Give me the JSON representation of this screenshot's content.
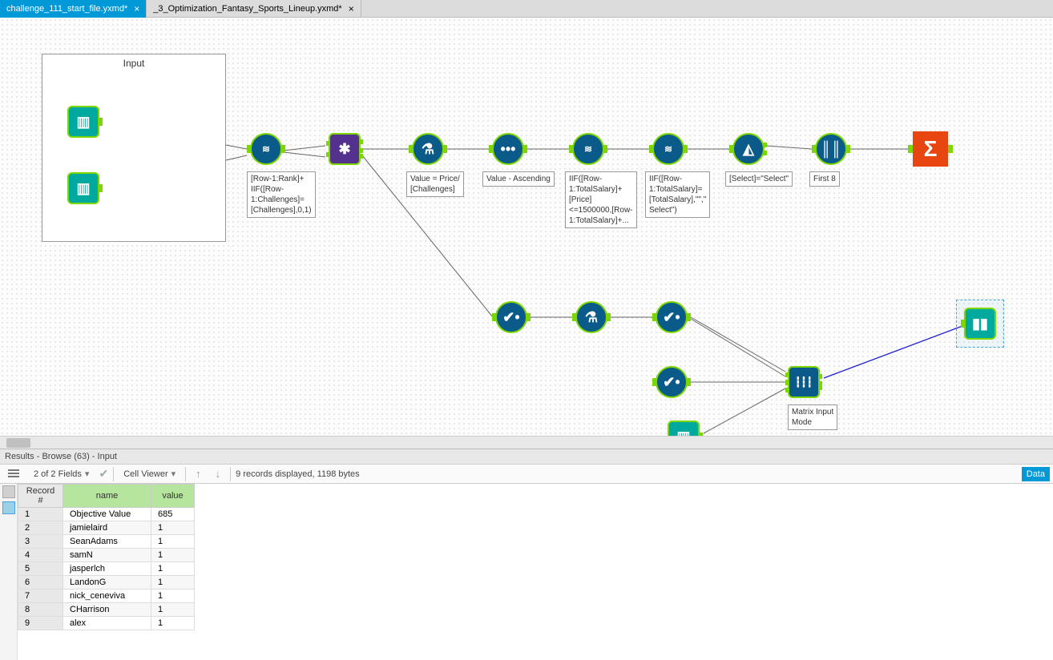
{
  "tabs": [
    {
      "label": "challenge_111_start_file.yxmd*",
      "active": true
    },
    {
      "label": "_3_Optimization_Fantasy_Sports_Lineup.yxmd*",
      "active": false
    }
  ],
  "canvas": {
    "group_label": "Input",
    "annotations": {
      "multirow1": "[Row-1:Rank]+\nIIF([Row-\n1:Challenges]=\n[Challenges],0,1)",
      "formula1": "Value = Price/\n[Challenges]",
      "sort1": "Value - Ascending",
      "multirow2": "IIF([Row-\n1:TotalSalary]+\n[Price]\n<=1500000,[Row-\n1:TotalSalary]+...",
      "multirow3": "IIF([Row-\n1:TotalSalary]=\n[TotalSalary],\"\",\"\nSelect\")",
      "filter1": "[Select]=\"Select\"",
      "sample1": "First 8",
      "opt1": "Matrix Input\nMode"
    }
  },
  "results": {
    "title": "Results - Browse (63) - Input",
    "fields_label": "2 of 2 Fields",
    "cell_viewer": "Cell Viewer",
    "status": "9 records displayed, 1198 bytes",
    "side_button": "Data",
    "columns": {
      "rec": "Record #",
      "name": "name",
      "value": "value"
    },
    "rows": [
      {
        "rec": "1",
        "name": "Objective Value",
        "value": "685"
      },
      {
        "rec": "2",
        "name": "jamielaird",
        "value": "1"
      },
      {
        "rec": "3",
        "name": "SeanAdams",
        "value": "1"
      },
      {
        "rec": "4",
        "name": "samN",
        "value": "1"
      },
      {
        "rec": "5",
        "name": "jasperlch",
        "value": "1"
      },
      {
        "rec": "6",
        "name": "LandonG",
        "value": "1"
      },
      {
        "rec": "7",
        "name": "nick_ceneviva",
        "value": "1"
      },
      {
        "rec": "8",
        "name": "CHarrison",
        "value": "1"
      },
      {
        "rec": "9",
        "name": "alex",
        "value": "1"
      }
    ]
  }
}
